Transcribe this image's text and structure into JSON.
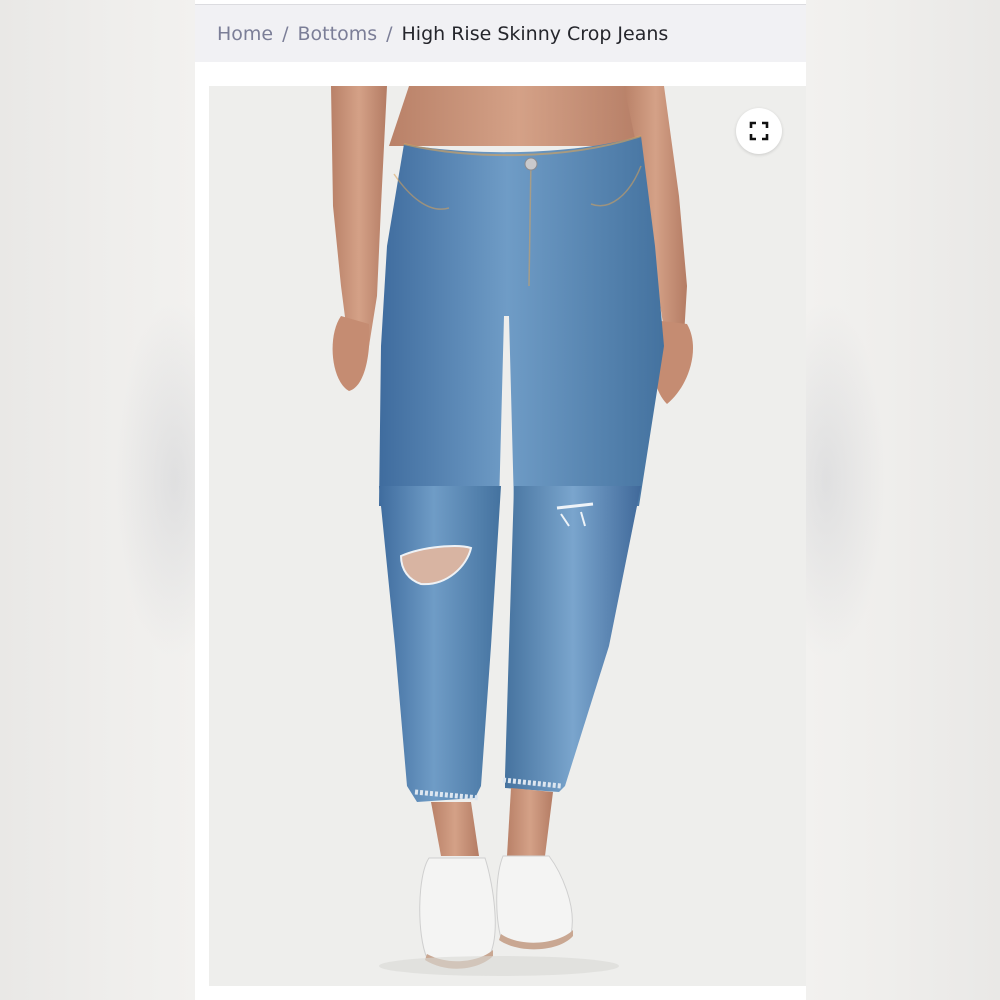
{
  "breadcrumb": {
    "items": [
      {
        "label": "Home"
      },
      {
        "label": "Bottoms"
      }
    ],
    "separator": "/",
    "current": "High Rise Skinny Crop Jeans"
  },
  "product_image": {
    "icon": "expand-icon",
    "description_colors": {
      "background": "#eeeeec",
      "denim": "#4f7fb0",
      "denim_light": "#87add2",
      "skin": "#c9927a",
      "shoe": "#f3f3f3"
    }
  }
}
